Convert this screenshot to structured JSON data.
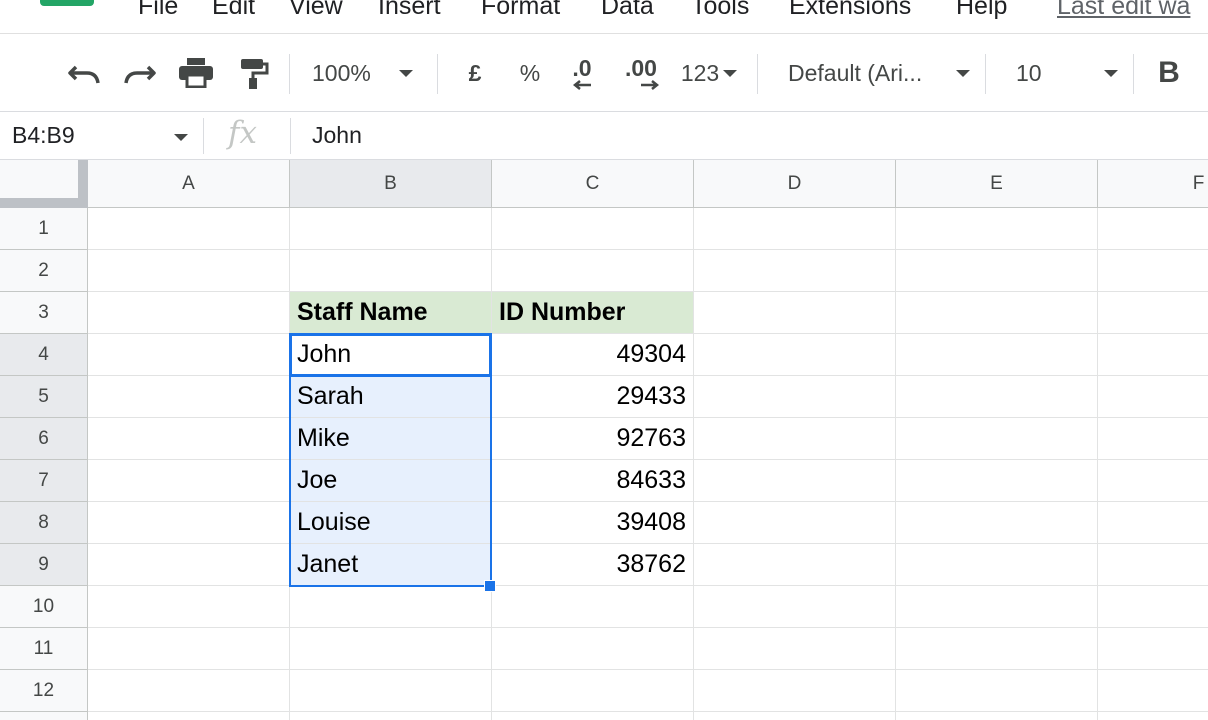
{
  "menu": {
    "items": [
      "File",
      "Edit",
      "View",
      "Insert",
      "Format",
      "Data",
      "Tools",
      "Extensions",
      "Help"
    ],
    "last_edit": "Last edit wa"
  },
  "toolbar": {
    "zoom": "100%",
    "currency": "£",
    "percent": "%",
    "decrease_decimal": ".0",
    "increase_decimal": ".00",
    "number_format": "123",
    "font": "Default (Ari...",
    "font_size": "10",
    "bold": "B"
  },
  "formula_bar": {
    "name_box": "B4:B9",
    "fx": "fx",
    "value": "John"
  },
  "sheet": {
    "columns": [
      "A",
      "B",
      "C",
      "D",
      "E",
      "F"
    ],
    "rows": [
      "1",
      "2",
      "3",
      "4",
      "5",
      "6",
      "7",
      "8",
      "9",
      "10",
      "11",
      "12"
    ],
    "header": {
      "b": "Staff Name",
      "c": "ID Number"
    },
    "data": [
      {
        "name": "John",
        "id": "49304"
      },
      {
        "name": "Sarah",
        "id": "29433"
      },
      {
        "name": "Mike",
        "id": "92763"
      },
      {
        "name": "Joe",
        "id": "84633"
      },
      {
        "name": "Louise",
        "id": "39408"
      },
      {
        "name": "Janet",
        "id": "38762"
      }
    ]
  },
  "colors": {
    "selection": "#1a73e8",
    "header_fill": "#d9ead3",
    "selection_fill": "#e7f0fd"
  }
}
